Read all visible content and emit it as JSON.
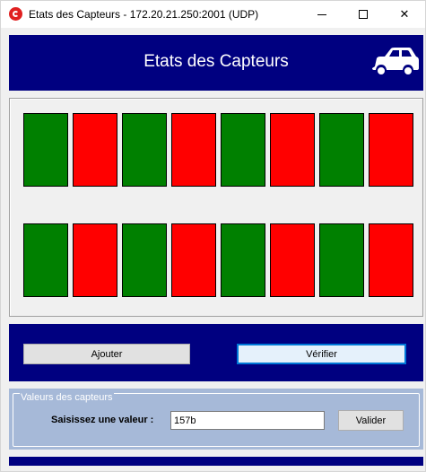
{
  "window": {
    "title": "Etats des Capteurs - 172.20.21.250:2001 (UDP)",
    "controls": {
      "minimize": "minimize",
      "maximize": "maximize",
      "close": "✕"
    }
  },
  "header": {
    "title": "Etats des Capteurs",
    "icon": "car-icon"
  },
  "colors": {
    "navy": "#000080",
    "sensor_on": "#008000",
    "sensor_off": "#ff0000",
    "group_bg": "#a6b9d8"
  },
  "sensors": {
    "row1": [
      "on",
      "off",
      "on",
      "off",
      "on",
      "off",
      "on",
      "off"
    ],
    "row2": [
      "on",
      "off",
      "on",
      "off",
      "on",
      "off",
      "on",
      "off"
    ]
  },
  "actions": {
    "add_label": "Ajouter",
    "verify_label": "Vérifier"
  },
  "group": {
    "legend": "Valeurs des capteurs",
    "input_label": "Saisissez une valeur :",
    "input_value": "157b",
    "validate_label": "Valider"
  }
}
